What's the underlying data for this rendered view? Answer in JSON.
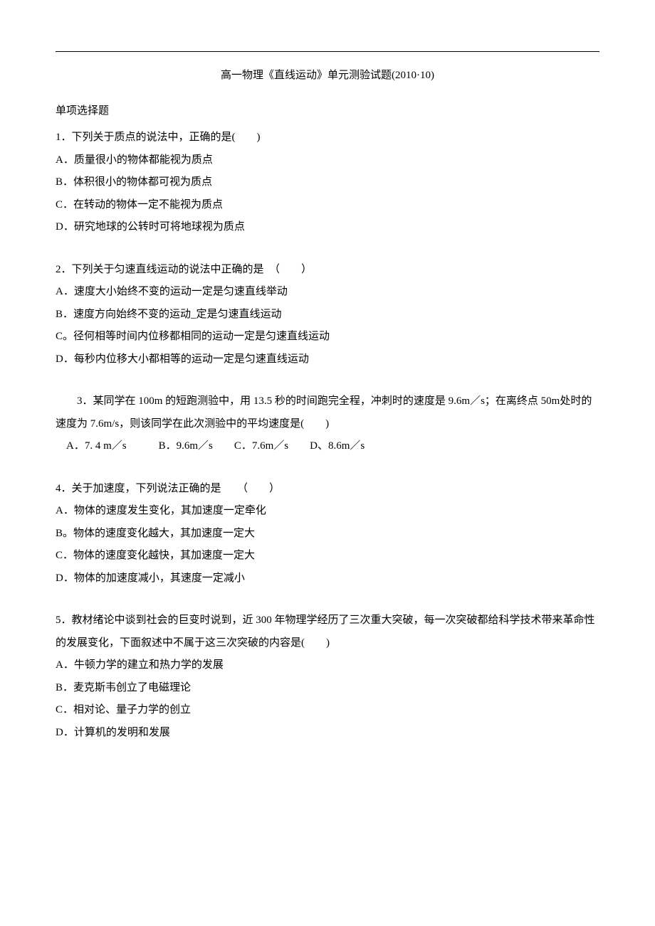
{
  "title": "高一物理《直线运动》单元测验试题(2010·10)",
  "section_heading": "单项选择题",
  "questions": [
    {
      "stem": "1．下列关于质点的说法中，正确的是(　　)",
      "options": [
        "A．质量很小的物体都能视为质点",
        "B．体积很小的物体都可视为质点",
        "C．在转动的物体一定不能视为质点",
        "D．研究地球的公转时可将地球视为质点"
      ]
    },
    {
      "stem": "2．下列关于匀速直线运动的说法中正确的是　（　　）",
      "options": [
        "A．速度大小始终不变的运动一定是匀速直线举动",
        "B．速度方向始终不变的运动_定是匀速直线运动",
        "C。径何相等时间内位移都相同的运动一定是匀速直线运动",
        "D．每秒内位移大小都相等的运动一定是匀速直线运动"
      ]
    },
    {
      "stem_prefix": "　　3．某同学在 100m 的短跑测验中，用 13.5 秒的时间跑完全程，冲刺时的速度是 9.6m／s；在离终点 50m处时的速度为 7.6m/s，则该同学在此次测验中的平均速度是(　　)",
      "inline_options": "　A．7. 4 m／s　　　B．9.6m／s　　C．7.6m／s　　D、8.6m／s"
    },
    {
      "stem": "4．关于加速度，下列说法正确的是　　（　　）",
      "options": [
        "A．物体的速度发生变化，其加速度一定牵化",
        "B。物体的速度变化越大，其加速度一定大",
        "C．物体的速度变化越快，其加速度一定大",
        "D．物体的加速度减小，其速度一定减小"
      ]
    },
    {
      "stem": "5．教材绪论中谈到社会的巨变时说到，近 300 年物理学经历了三次重大突破，每一次突破都给科学技术带来革命性的发展变化，下面叙述中不属于这三次突破的内容是(　　)",
      "options": [
        "A．牛顿力学的建立和热力学的发展",
        "B．麦克斯韦创立了电磁理论",
        "C．相对论、量子力学的创立",
        "D．计算机的发明和发展"
      ]
    }
  ]
}
